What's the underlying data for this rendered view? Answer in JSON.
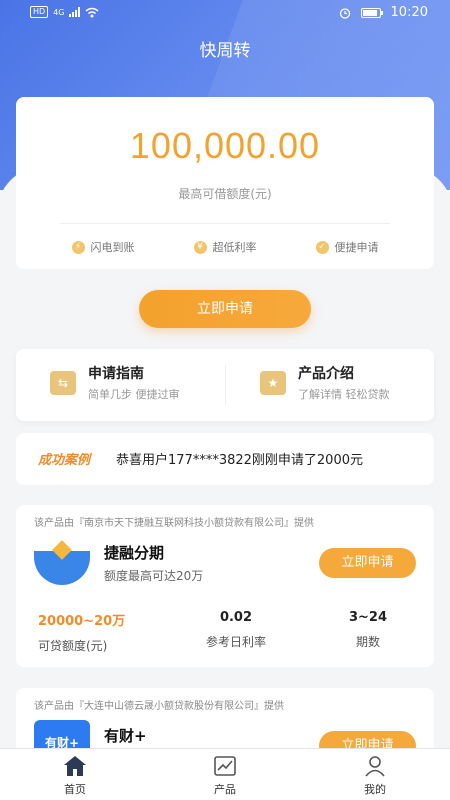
{
  "status_bar": {
    "left_badges": [
      "HD",
      "4G"
    ],
    "time": "10:20",
    "icons": [
      "signal-icon",
      "wifi-icon",
      "alarm-icon",
      "battery-icon"
    ]
  },
  "header": {
    "title": "快周转"
  },
  "amount_card": {
    "amount": "100,000.00",
    "label": "最高可借额度(元)",
    "features": [
      {
        "icon": "lightning-icon",
        "label": "闪电到账"
      },
      {
        "icon": "yen-icon",
        "label": "超低利率"
      },
      {
        "icon": "check-icon",
        "label": "便捷申请"
      }
    ]
  },
  "main_apply": {
    "label": "立即申请"
  },
  "guide": {
    "left": {
      "title": "申请指南",
      "subtitle": "简单几步 便捷过审",
      "icon": "swap-icon"
    },
    "right": {
      "title": "产品介绍",
      "subtitle": "了解详情 轻松贷款",
      "icon": "star-icon"
    }
  },
  "case": {
    "tag": "成功案例",
    "text": "恭喜用户177****3822刚刚申请了2000元"
  },
  "products": [
    {
      "provider": "该产品由『南京市天下捷融互联网科技小额贷款有限公司』提供",
      "name": "捷融分期",
      "desc": "额度最高可达20万",
      "apply_label": "立即申请",
      "stats": [
        {
          "value": "20000~20万",
          "label": "可贷额度(元)"
        },
        {
          "value": "0.02",
          "label": "参考日利率"
        },
        {
          "value": "3~24",
          "label": "期数"
        }
      ]
    },
    {
      "provider": "该产品由『大连中山德云晟小额贷款股份有限公司』提供",
      "name": "有财+",
      "logo_text": "有财+",
      "apply_label": "立即申请"
    }
  ],
  "tabbar": [
    {
      "label": "首页",
      "icon": "home-icon"
    },
    {
      "label": "产品",
      "icon": "chart-icon"
    },
    {
      "label": "我的",
      "icon": "user-icon"
    }
  ],
  "colors": {
    "accent": "#f4a12d",
    "header": "#4a74e6",
    "logo_blue": "#3a86e8"
  }
}
